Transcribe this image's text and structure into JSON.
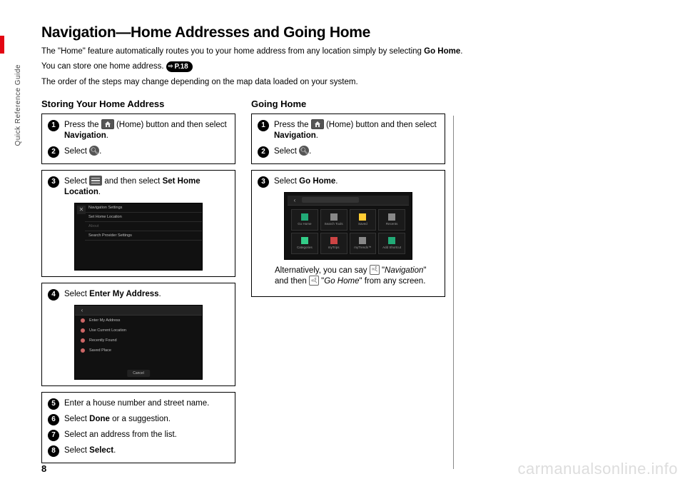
{
  "side_label": "Quick Reference Guide",
  "page_number": "8",
  "watermark": "carmanualsonline.info",
  "title": "Navigation—Home Addresses and Going Home",
  "intro": {
    "line1_a": "The \"Home\" feature automatically routes you to your home address from any location simply by selecting ",
    "line1_b": "Go Home",
    "line1_c": ".",
    "line2_a": "You can store one home address. ",
    "badge": "P.18",
    "line3": "The order of the steps may change depending on the map data loaded on your system."
  },
  "left": {
    "heading": "Storing Your Home Address",
    "box1": {
      "s1_a": "Press the ",
      "s1_b": " (Home) button and then select ",
      "s1_c": "Navigation",
      "s1_d": ".",
      "s2_a": "Select ",
      "s2_b": "."
    },
    "box2": {
      "s3_a": "Select ",
      "s3_b": " and then select ",
      "s3_c": "Set Home Location",
      "s3_d": ".",
      "ss": {
        "r1": "Navigation Settings",
        "r2": "Set Home Location",
        "r3": "About",
        "r4": "Search Provider Settings"
      }
    },
    "box3": {
      "s4_a": "Select ",
      "s4_b": "Enter My Address",
      "s4_c": ".",
      "ss": {
        "r1": "Enter My Address",
        "r2": "Use Current Location",
        "r3": "Recently Found",
        "r4": "Saved Place",
        "cancel": "Cancel"
      }
    },
    "box4": {
      "s5": "Enter a house number and street name.",
      "s6_a": "Select ",
      "s6_b": "Done",
      "s6_c": " or a suggestion.",
      "s7": "Select an address from the list.",
      "s8_a": "Select ",
      "s8_b": "Select",
      "s8_c": "."
    }
  },
  "right": {
    "heading": "Going Home",
    "box1": {
      "s1_a": "Press the ",
      "s1_b": " (Home) button and then select ",
      "s1_c": "Navigation",
      "s1_d": ".",
      "s2_a": "Select ",
      "s2_b": "."
    },
    "box2": {
      "s3_a": "Select ",
      "s3_b": "Go Home",
      "s3_c": ".",
      "ss": {
        "tiles": [
          {
            "lbl": "Go Home",
            "color": "#2a7"
          },
          {
            "lbl": "Search Tools",
            "color": "#888"
          },
          {
            "lbl": "Saved",
            "color": "#fc3"
          },
          {
            "lbl": "Recents",
            "color": "#888"
          },
          {
            "lbl": "Categories",
            "color": "#3c8"
          },
          {
            "lbl": "myTrips",
            "color": "#c44"
          },
          {
            "lbl": "myTrends™",
            "color": "#888"
          },
          {
            "lbl": "Add Shortcut",
            "color": "#2a7"
          }
        ]
      },
      "note_a": "Alternatively, you can say ",
      "note_b": " \"",
      "note_c": "Navigation",
      "note_d": "\" and then ",
      "note_e": " \"",
      "note_f": "Go Home",
      "note_g": "\" from any screen."
    }
  }
}
